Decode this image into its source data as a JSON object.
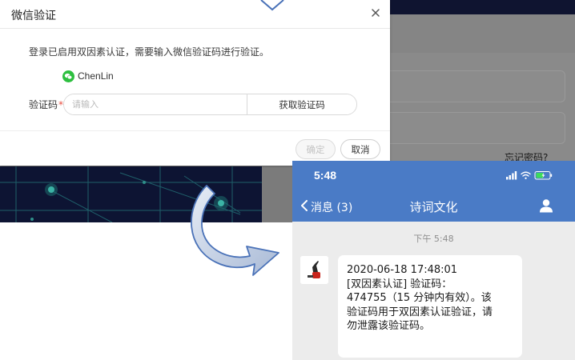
{
  "dialog": {
    "title": "微信验证",
    "description": "登录已启用双因素认证，需要输入微信验证码进行验证。",
    "wechat_account": "ChenLin",
    "code_label": "验证码",
    "code_required_mark": "*",
    "code_input_value": "",
    "code_placeholder": "请输入",
    "get_code_button": "获取验证码",
    "confirm_button": "确定",
    "cancel_button": "取消",
    "confirm_enabled": false
  },
  "background": {
    "forgot_password": "忘记密码?"
  },
  "phone": {
    "status_time": "5:48",
    "status_icons": [
      "cellular-signal-icon",
      "wifi-icon",
      "battery-charging-icon"
    ],
    "back_label": "消息 (3)",
    "chat_title": "诗词文化",
    "message_time": "下午 5:48",
    "message_lines": [
      "2020-06-18 17:48:01",
      "[双因素认证] 验证码：",
      "474755（15 分钟内有效）。该",
      "验证码用于双因素认证验证，请",
      "勿泄露该验证码。"
    ]
  },
  "colors": {
    "phone_header": "#4a7bc6",
    "wechat_green": "#2dbf3f",
    "required_red": "#e84c3d",
    "arrow_stroke": "#4a72b8",
    "arrow_fill_light": "#dfe6f1",
    "arrow_fill_dark": "#a9bad6"
  }
}
